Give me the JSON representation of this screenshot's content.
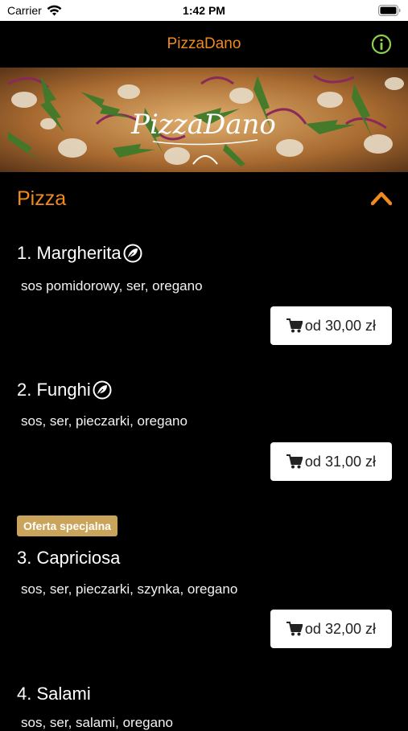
{
  "status_bar": {
    "carrier": "Carrier",
    "time": "1:42 PM"
  },
  "nav": {
    "title": "PizzaDano",
    "info_icon": "info-circle-icon",
    "accent_color": "#f08a1c",
    "info_color": "#8fd14f"
  },
  "hero": {
    "logo_text": "PizzaDano"
  },
  "section": {
    "title": "Pizza",
    "toggle_icon": "chevron-up-icon"
  },
  "menu": {
    "items": [
      {
        "name": "1. Margherita",
        "vegetarian": true,
        "description": "sos pomidorowy, ser, oregano",
        "price": "od 30,00 zł"
      },
      {
        "name": "2. Funghi",
        "vegetarian": true,
        "description": "sos, ser, pieczarki, oregano",
        "price": "od 31,00 zł"
      },
      {
        "badge": "Oferta specjalna",
        "name": "3. Capriciosa",
        "vegetarian": false,
        "description": "sos, ser, pieczarki, szynka, oregano",
        "price": "od 32,00 zł"
      },
      {
        "name": "4. Salami",
        "vegetarian": false,
        "description": "sos, ser, salami, oregano"
      }
    ]
  },
  "colors": {
    "badge": "#c9a45a",
    "background": "#000000"
  }
}
